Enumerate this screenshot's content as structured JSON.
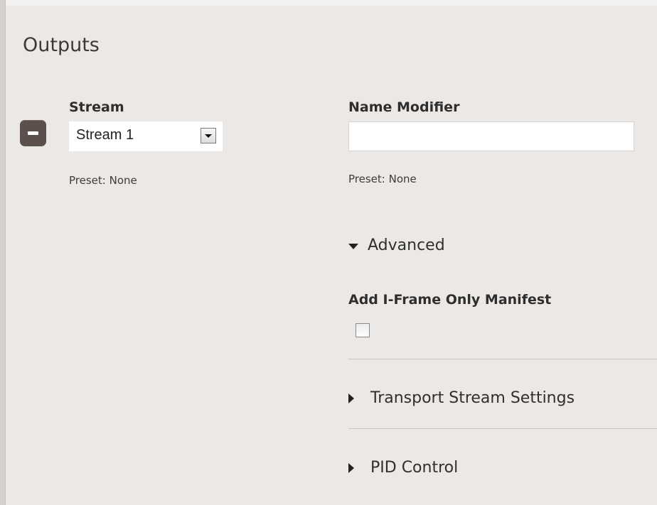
{
  "section": {
    "title": "Outputs"
  },
  "stream": {
    "label": "Stream",
    "selected": "Stream 1",
    "preset": "Preset: None"
  },
  "name_modifier": {
    "label": "Name Modifier",
    "value": "",
    "preset": "Preset: None"
  },
  "advanced": {
    "label": "Advanced",
    "expanded": true,
    "iframe_label": "Add I-Frame Only Manifest",
    "iframe_checked": false
  },
  "collapsibles": {
    "transport": "Transport Stream Settings",
    "pid": "PID Control"
  },
  "icons": {
    "remove": "minus-icon",
    "dropdown": "chevron-down-icon",
    "expanded": "triangle-down-icon",
    "collapsed": "triangle-right-icon"
  },
  "colors": {
    "background": "#ece8e5",
    "remove_button": "#5b504b",
    "divider": "#c9c5c2"
  }
}
